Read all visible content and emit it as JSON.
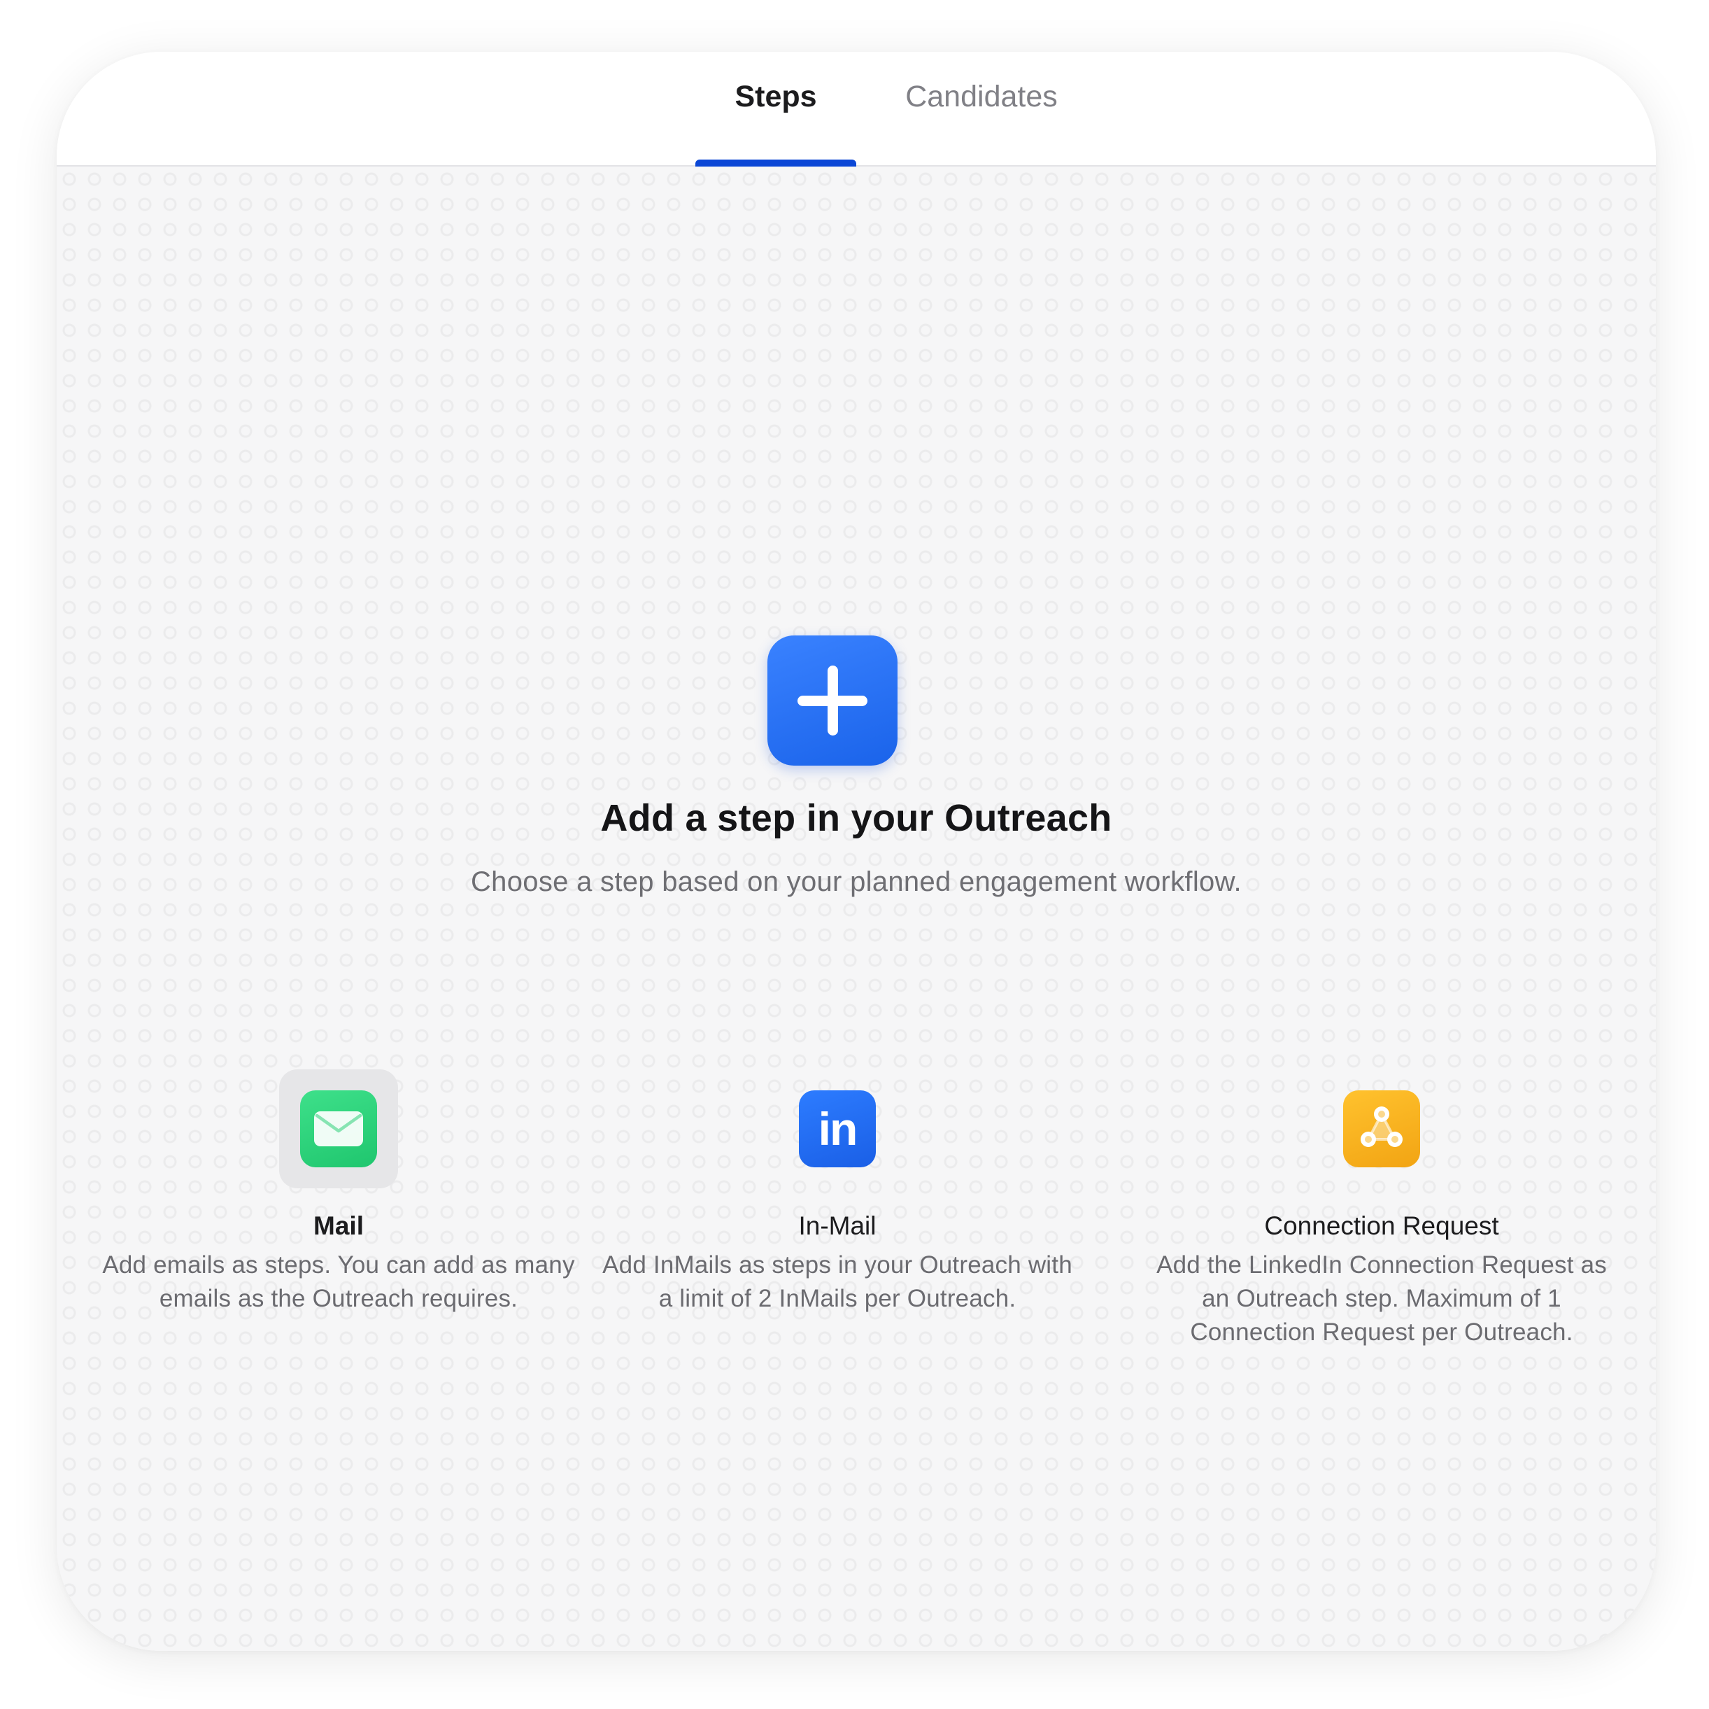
{
  "tabs": [
    {
      "label": "Steps",
      "active": true
    },
    {
      "label": "Candidates",
      "active": false
    }
  ],
  "accent_color": "#0b47d6",
  "empty_state": {
    "icon": "plus-icon",
    "title": "Add a step in your Outreach",
    "subtitle": "Choose a step based on your planned engagement workflow."
  },
  "options": [
    {
      "icon": "mail-icon",
      "title": "Mail",
      "selected": true,
      "color": "#22c96f",
      "description": "Add emails as steps. You can add as many emails as the Outreach requires."
    },
    {
      "icon": "linkedin-icon",
      "icon_text": "in",
      "title": "In-Mail",
      "selected": false,
      "color": "#1f66ee",
      "description": "Add InMails as steps in your Outreach with a limit of 2 InMails per Outreach."
    },
    {
      "icon": "connection-network-icon",
      "title": "Connection Request",
      "selected": false,
      "color": "#f7b21c",
      "description": "Add the LinkedIn Connection Request as an Outreach step. Maximum of 1 Connection Request per Outreach."
    }
  ]
}
